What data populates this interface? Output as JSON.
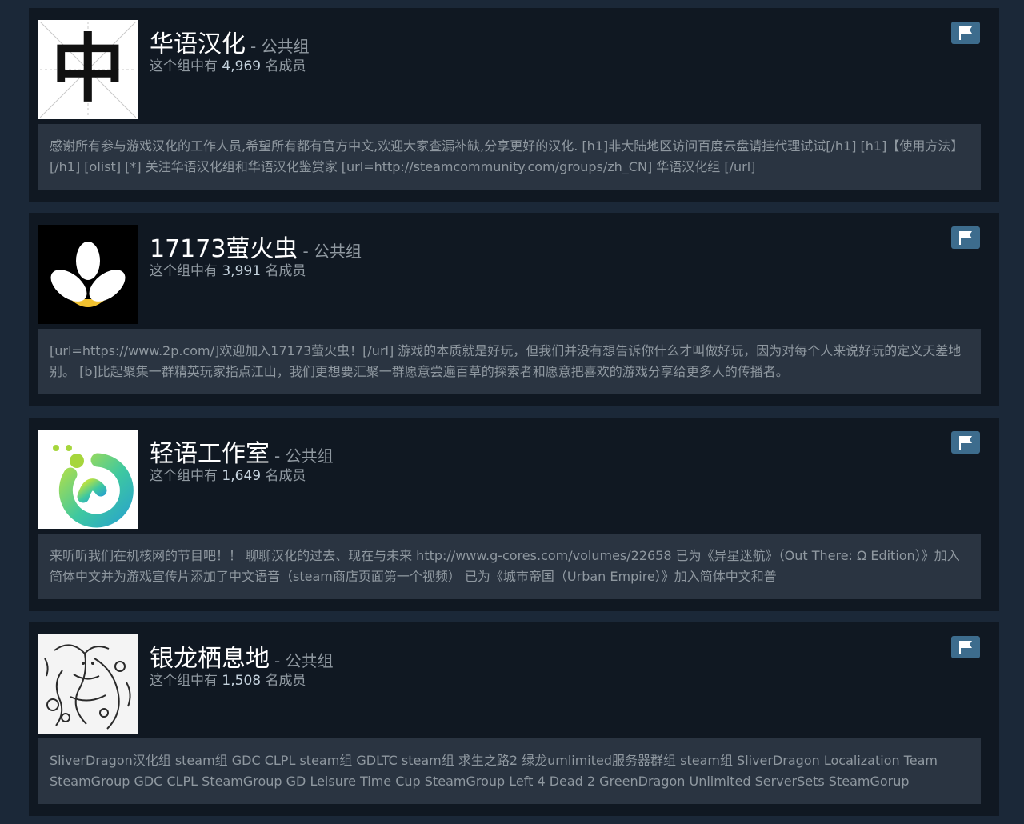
{
  "groups": [
    {
      "name": "华语汉化",
      "type_suffix": "- 公共组",
      "members_prefix": "这个组中有",
      "members_count": "4,969",
      "members_suffix": "名成员",
      "avatar_char": "中",
      "description": "感谢所有参与游戏汉化的工作人员,希望所有都有官方中文,欢迎大家查漏补缺,分享更好的汉化. [h1]非大陆地区访问百度云盘请挂代理试试[/h1] [h1]【使用方法】[/h1] [olist] [*] 关注华语汉化组和华语汉化鉴赏家 [url=http://steamcommunity.com/groups/zh_CN] 华语汉化组 [/url]"
    },
    {
      "name": "17173萤火虫",
      "type_suffix": "- 公共组",
      "members_prefix": "这个组中有",
      "members_count": "3,991",
      "members_suffix": "名成员",
      "description": "[url=https://www.2p.com/]欢迎加入17173萤火虫！[/url] 游戏的本质就是好玩，但我们并没有想告诉你什么才叫做好玩，因为对每个人来说好玩的定义天差地别。 [b]比起聚集一群精英玩家指点江山，我们更想要汇聚一群愿意尝遍百草的探索者和愿意把喜欢的游戏分享给更多人的传播者。"
    },
    {
      "name": "轻语工作室",
      "type_suffix": "- 公共组",
      "members_prefix": "这个组中有",
      "members_count": "1,649",
      "members_suffix": "名成员",
      "description": "来听听我们在机核网的节目吧！！ 聊聊汉化的过去、现在与未来 http://www.g-cores.com/volumes/22658 已为《异星迷航》（Out There: Ω Edition）》加入简体中文并为游戏宣传片添加了中文语音（steam商店页面第一个视频） 已为《城市帝国（Urban Empire）》加入简体中文和普"
    },
    {
      "name": "银龙栖息地",
      "type_suffix": "- 公共组",
      "members_prefix": "这个组中有",
      "members_count": "1,508",
      "members_suffix": "名成员",
      "description": "SliverDragon汉化组 steam组 GDC CLPL steam组 GDLTC steam组 求生之路2 绿龙umlimited服务器群组 steam组 SliverDragon Localization Team SteamGroup GDC CLPL SteamGroup GD Leisure Time Cup SteamGroup Left 4 Dead 2 GreenDragon Unlimited ServerSets SteamGorup"
    }
  ],
  "icons": {
    "report": "flag-icon"
  },
  "colors": {
    "page_bg": "#1b2838",
    "card_bg": "#101822",
    "desc_bg": "#2a3441",
    "report_button": "#3d6c8d",
    "muted_text": "#8f98a0"
  }
}
